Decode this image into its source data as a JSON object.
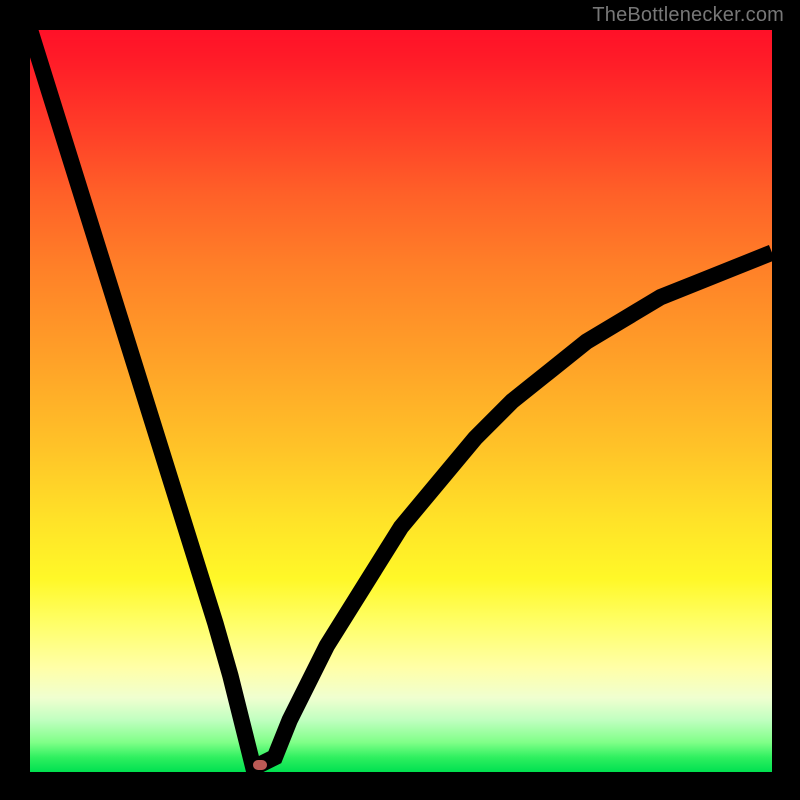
{
  "watermark": "TheBottlenecker.com",
  "colors": {
    "marker": "#bb5a55",
    "curve": "#000000",
    "frame": "#000000"
  },
  "chart_data": {
    "type": "line",
    "title": "",
    "xlabel": "",
    "ylabel": "",
    "xlim": [
      0,
      100
    ],
    "ylim": [
      0,
      100
    ],
    "series": [
      {
        "name": "bottleneck-curve",
        "x": [
          0,
          5,
          10,
          15,
          20,
          25,
          27,
          29,
          30,
          31,
          33,
          35,
          40,
          45,
          50,
          55,
          60,
          65,
          70,
          75,
          80,
          85,
          90,
          95,
          100
        ],
        "values": [
          100,
          84,
          68,
          52,
          36,
          20,
          13,
          5,
          1,
          1,
          2,
          7,
          17,
          25,
          33,
          39,
          45,
          50,
          54,
          58,
          61,
          64,
          66,
          68,
          70
        ]
      }
    ],
    "markers": [
      {
        "name": "optimum-point",
        "x": 31,
        "y": 1
      }
    ]
  }
}
